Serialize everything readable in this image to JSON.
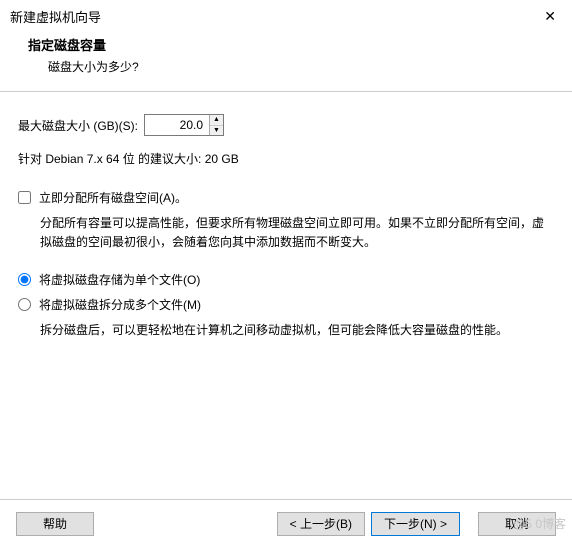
{
  "window": {
    "title": "新建虚拟机向导"
  },
  "heading": {
    "title": "指定磁盘容量",
    "subtitle": "磁盘大小为多少?"
  },
  "disk": {
    "size_label": "最大磁盘大小 (GB)(S):",
    "size_value": "20.0",
    "recommend": "针对 Debian 7.x 64 位 的建议大小: 20 GB"
  },
  "allocate": {
    "label": "立即分配所有磁盘空间(A)。",
    "desc": "分配所有容量可以提高性能，但要求所有物理磁盘空间立即可用。如果不立即分配所有空间，虚拟磁盘的空间最初很小，会随着您向其中添加数据而不断变大。"
  },
  "store": {
    "single": "将虚拟磁盘存储为单个文件(O)",
    "split": "将虚拟磁盘拆分成多个文件(M)",
    "split_desc": "拆分磁盘后，可以更轻松地在计算机之间移动虚拟机，但可能会降低大容量磁盘的性能。"
  },
  "buttons": {
    "help": "帮助",
    "back": "< 上一步(B)",
    "next": "下一步(N) >",
    "cancel": "取消"
  },
  "watermark": "@5    0博客"
}
